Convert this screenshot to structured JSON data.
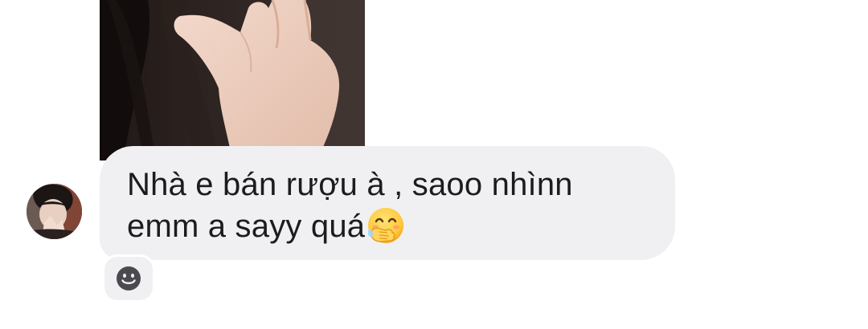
{
  "message": {
    "line1": "Nhà e bán rượu à , saoo nhìnn",
    "line2": "emm a sayy quá",
    "emoji": "face-with-hand-over-mouth"
  },
  "photo": {
    "icon": "photo-attachment"
  },
  "avatar": {
    "icon": "sender-avatar"
  },
  "reaction": {
    "icon": "smiley-icon"
  },
  "colors": {
    "bubble": "#f0f0f3",
    "text": "#1c1c1e",
    "background": "#ffffff",
    "reaction_icon": "#4a4a4f"
  }
}
